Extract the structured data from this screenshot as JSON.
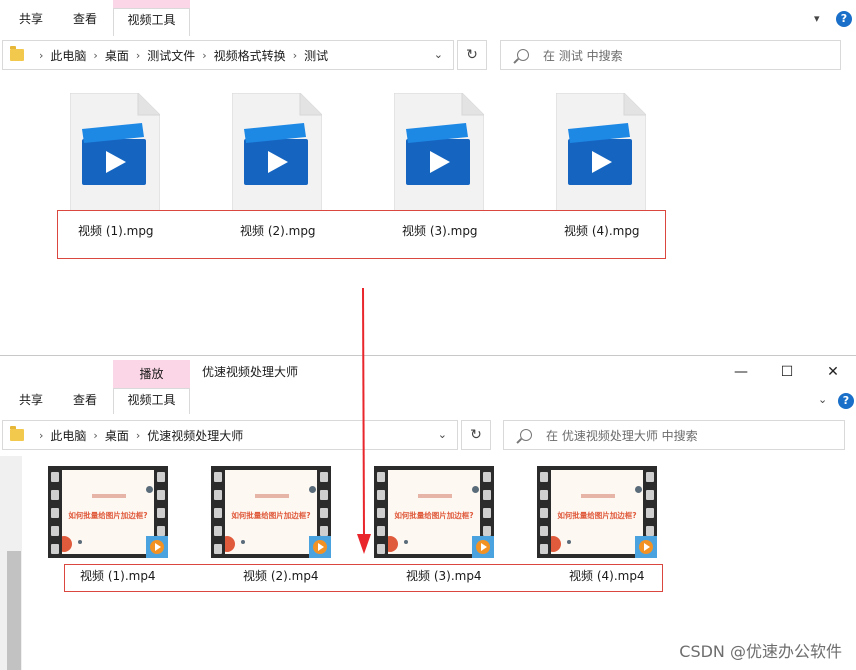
{
  "top_window": {
    "ribbon": {
      "tab_share": "共享",
      "tab_view": "查看",
      "tab_video_tools": "视频工具"
    },
    "breadcrumb": [
      "此电脑",
      "桌面",
      "测试文件",
      "视频格式转换",
      "测试"
    ],
    "search_placeholder": "在 测试 中搜索",
    "files": [
      "视频 (1).mpg",
      "视频 (2).mpg",
      "视频 (3).mpg",
      "视频 (4).mpg"
    ]
  },
  "bottom_window": {
    "ribbon": {
      "tab_play": "播放",
      "title": "优速视频处理大师",
      "tab_share": "共享",
      "tab_view": "查看",
      "tab_video_tools": "视频工具"
    },
    "breadcrumb": [
      "此电脑",
      "桌面",
      "优速视频处理大师"
    ],
    "search_placeholder": "在 优速视频处理大师 中搜索",
    "thumbnail_caption": "如何批量给图片加边框?",
    "files": [
      "视频 (1).mp4",
      "视频 (2).mp4",
      "视频 (3).mp4",
      "视频 (4).mp4"
    ]
  },
  "icons": {
    "folder": "folder-icon",
    "refresh": "refresh-icon",
    "search": "search-icon",
    "video_file": "video-file-icon",
    "play_badge": "play-badge-icon"
  },
  "colors": {
    "highlight_box": "#d9473f",
    "ribbon_context": "#fbd6e6",
    "help": "#1a6fc8",
    "arrow": "#e8262c"
  },
  "watermark": "CSDN @优速办公软件"
}
